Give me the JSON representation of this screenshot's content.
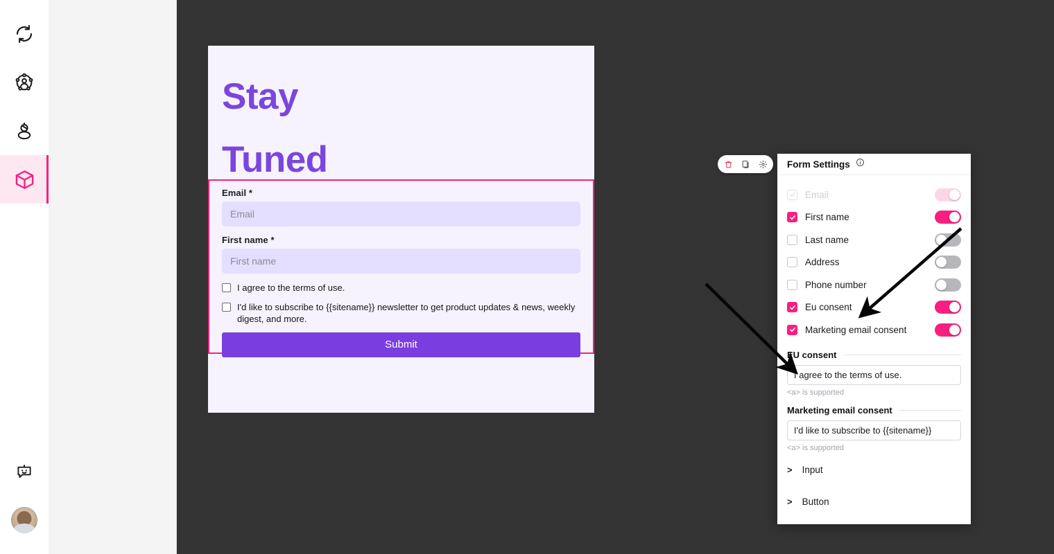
{
  "rail": {
    "items": [
      {
        "name": "sync-icon",
        "label": "Sync"
      },
      {
        "name": "contacts-icon",
        "label": "Contacts"
      },
      {
        "name": "audience-icon",
        "label": "Audience"
      },
      {
        "name": "cube-icon",
        "label": "Blocks"
      }
    ],
    "bottom": [
      {
        "name": "chatbot-icon",
        "label": "Assistant"
      },
      {
        "name": "avatar",
        "label": "Account"
      }
    ]
  },
  "mini_toolbar": {
    "delete_label": "Delete",
    "duplicate_label": "Duplicate",
    "settings_label": "Settings"
  },
  "page": {
    "hero": {
      "line1": "Stay",
      "line2": "Tuned"
    },
    "form": {
      "fields": [
        {
          "label": "Email *",
          "placeholder": "Email"
        },
        {
          "label": "First name *",
          "placeholder": "First name"
        }
      ],
      "checkboxes": [
        {
          "text": "I agree to the terms of use.",
          "checked": false
        },
        {
          "text": "I'd like to subscribe to {{sitename}} newsletter to get product updates & news, weekly digest, and more.",
          "checked": false
        }
      ],
      "submit_label": "Submit"
    }
  },
  "settings": {
    "title": "Form Settings",
    "info_icon": "info-icon",
    "rows": [
      {
        "label": "Email",
        "checked": true,
        "disabled": true,
        "toggle": "faint"
      },
      {
        "label": "First name",
        "checked": true,
        "disabled": false,
        "toggle": "on"
      },
      {
        "label": "Last name",
        "checked": false,
        "disabled": false,
        "toggle": "off"
      },
      {
        "label": "Address",
        "checked": false,
        "disabled": false,
        "toggle": "off"
      },
      {
        "label": "Phone number",
        "checked": false,
        "disabled": false,
        "toggle": "off"
      },
      {
        "label": "Eu consent",
        "checked": true,
        "disabled": false,
        "toggle": "on"
      },
      {
        "label": "Marketing email consent",
        "checked": true,
        "disabled": false,
        "toggle": "on"
      }
    ],
    "sections": [
      {
        "title": "EU consent",
        "value": "I agree to the terms of use.",
        "hint": "<a> is supported"
      },
      {
        "title": "Marketing email consent",
        "value": "I'd like to subscribe to {{sitename}}",
        "hint": "<a> is supported"
      }
    ],
    "accordions": [
      {
        "label": "Input",
        "chevron": ">"
      },
      {
        "label": "Button",
        "chevron": ">"
      }
    ]
  },
  "colors": {
    "accent_pink": "#f81f7f",
    "accent_purple": "#7a3ee0",
    "hero_purple": "#7b46dd",
    "canvas_dark": "#333333",
    "field_lavender": "#e4deff",
    "page_bg": "#f6f3ff"
  }
}
